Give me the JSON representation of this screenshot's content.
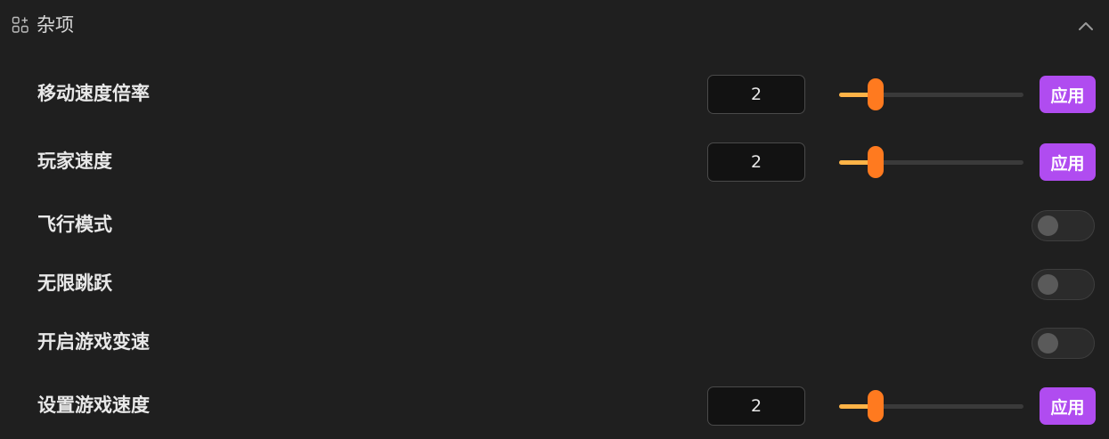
{
  "section": {
    "title": "杂项",
    "icon": "apps-add-icon",
    "collapse_icon": "chevron-up-icon"
  },
  "colors": {
    "background": "#1f1f1f",
    "accent_button": "#b04cf0",
    "slider_fill": "#ffb347",
    "slider_thumb": "#ff7a1f",
    "toggle_off": "#2b2b2b"
  },
  "rows": [
    {
      "label": "移动速度倍率",
      "type": "number-slider",
      "value": "2",
      "slider_fraction": 0.2,
      "apply_label": "应用"
    },
    {
      "label": "玩家速度",
      "type": "number-slider",
      "value": "2",
      "slider_fraction": 0.2,
      "apply_label": "应用"
    },
    {
      "label": "飞行模式",
      "type": "toggle",
      "on": false
    },
    {
      "label": "无限跳跃",
      "type": "toggle",
      "on": false
    },
    {
      "label": "开启游戏变速",
      "type": "toggle",
      "on": false
    },
    {
      "label": "设置游戏速度",
      "type": "number-slider",
      "value": "2",
      "slider_fraction": 0.2,
      "apply_label": "应用"
    }
  ]
}
